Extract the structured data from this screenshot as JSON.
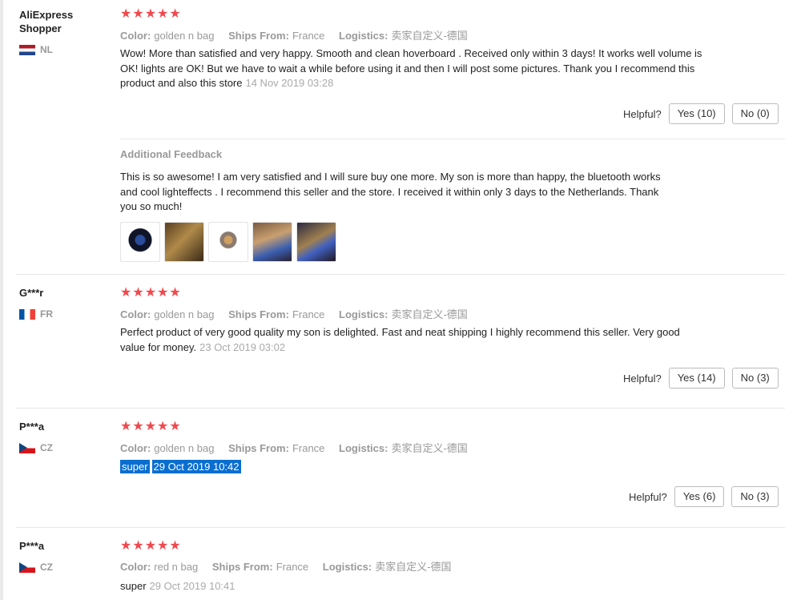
{
  "labels": {
    "color": "Color:",
    "ships_from": "Ships From:",
    "logistics": "Logistics:",
    "helpful": "Helpful?",
    "additional_feedback": "Additional Feedback"
  },
  "colors": {
    "star": "#f0494e",
    "selection": "#0a6ed1"
  },
  "reviews": [
    {
      "user": "AliExpress Shopper",
      "country": "NL",
      "color": "golden n bag",
      "ships_from": "France",
      "logistics": "卖家自定义-德国",
      "text": "Wow! More than satisfied and very happy. Smooth and clean hoverboard . Received only within 3 days! It works well volume is OK! lights are OK! But we have to wait a while before using it and then I will post some pictures. Thank you I recommend this product and also this store",
      "date": "14 Nov 2019 03:28",
      "yes": "Yes (10)",
      "no": "No (0)",
      "additional": {
        "text": "This is so awesome! I am very satisfied and I will sure buy one more. My son is more than happy, the bluetooth works and cool lighteffects . I recommend this seller and the store. I received it within only 3 days to the Netherlands. Thank you so much!"
      }
    },
    {
      "user": "G***r",
      "country": "FR",
      "color": "golden n bag",
      "ships_from": "France",
      "logistics": "卖家自定义-德国",
      "text": "Perfect product of very good quality my son is delighted. Fast and neat shipping I highly recommend this seller. Very good value for money.",
      "date": "23 Oct 2019 03:02",
      "yes": "Yes (14)",
      "no": "No (3)"
    },
    {
      "user": "P***a",
      "country": "CZ",
      "color": "golden n bag",
      "ships_from": "France",
      "logistics": "卖家自定义-德国",
      "text": "super",
      "date": "29 Oct 2019 10:42",
      "yes": "Yes (6)",
      "no": "No (3)"
    },
    {
      "user": "P***a",
      "country": "CZ",
      "color": "red n bag",
      "ships_from": "France",
      "logistics": "卖家自定义-德国",
      "text": "super",
      "date": "29 Oct 2019 10:41"
    }
  ]
}
